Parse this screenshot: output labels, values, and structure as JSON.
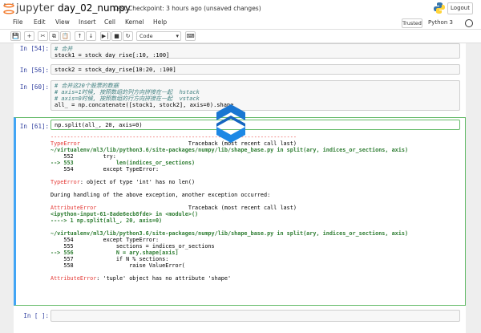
{
  "header": {
    "logo_text": "jupyter",
    "notebook_name": "day_02_numpy",
    "checkpoint": "Last Checkpoint: 3 hours ago (unsaved changes)",
    "logout_label": "Logout"
  },
  "menubar": {
    "items": [
      "File",
      "Edit",
      "View",
      "Insert",
      "Cell",
      "Kernel",
      "Help"
    ],
    "trusted_label": "Trusted",
    "kernel_name": "Python 3"
  },
  "toolbar": {
    "cell_type": "Code"
  },
  "cells": {
    "c54": {
      "prompt": "In [54]:",
      "line1": "# 合并",
      "line2": "stock1 = stock_day_rise[:10, :100]"
    },
    "c56": {
      "prompt": "In [56]:",
      "line1": "stock2 = stock_day_rise[10:20, :100]"
    },
    "c60": {
      "prompt": "In [60]:",
      "line1": "# 合并这20个股票的数据",
      "line2": "# axis=1时候, 按照数组的列方向拼接在一起  hstack",
      "line3": "# axis=0时候, 按照数组的行方向拼接在一起  vstack",
      "line4": "all_ = np.concatenate([stock1, stock2], axis=0).shape"
    },
    "c61": {
      "prompt": "In [61]:",
      "input": "np.split(all_, 20, axis=0)",
      "out": {
        "rule": "---------------------------------------------------------------------------",
        "e1_name": "TypeError",
        "e1_trace": "Traceback (most recent call last)",
        "e1_file": "~/virtualenv/ml3/lib/python3.6/site-packages/numpy/lib/shape_base.py in split(ary, indices_or_sections, axis)",
        "e1_l1": "    552         try:",
        "e1_arrow": "--> 553             len(indices_or_sections)",
        "e1_l3": "    554         except TypeError:",
        "e1_msg_name": "TypeError",
        "e1_msg": ": object of type 'int' has no len()",
        "during": "During handling of the above exception, another exception occurred:",
        "e2_name": "AttributeError",
        "e2_trace": "Traceback (most recent call last)",
        "e2_input": "<ipython-input-61-8ade6ecb8fde> in <module>()",
        "e2_arrow": "----> 1 np.split(all_, 20, axis=0)",
        "e3_file": "~/virtualenv/ml3/lib/python3.6/site-packages/numpy/lib/shape_base.py in split(ary, indices_or_sections, axis)",
        "e3_l1": "    554         except TypeError:",
        "e3_l2": "    555             sections = indices_or_sections",
        "e3_arrow": "--> 556             N = ary.shape[axis]",
        "e3_l4": "    557             if N % sections:",
        "e3_l5": "    558                 raise ValueError(",
        "e2_msg_name": "AttributeError",
        "e2_msg": ": 'tuple' object has no attribute 'shape'"
      }
    },
    "cempty": {
      "prompt": "In [ ]:"
    }
  },
  "colors": {
    "accent": "#f37726",
    "prompt": "#303f9f",
    "error": "#e53935",
    "selected_border": "#66bb6a"
  }
}
